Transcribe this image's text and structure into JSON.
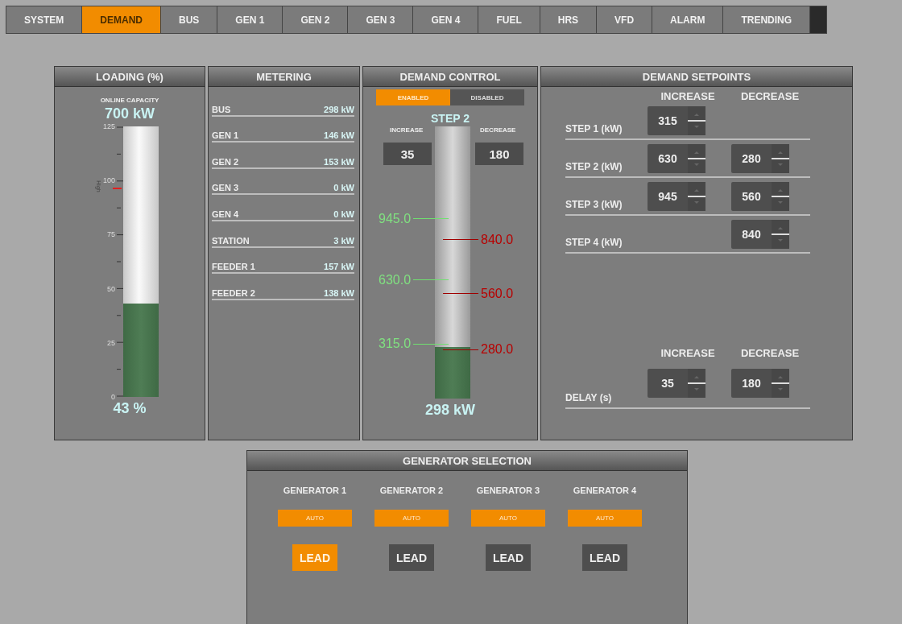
{
  "tabs": [
    {
      "label": "SYSTEM",
      "selected": false
    },
    {
      "label": "DEMAND",
      "selected": true
    },
    {
      "label": "BUS",
      "selected": false
    },
    {
      "label": "GEN 1",
      "selected": false
    },
    {
      "label": "GEN 2",
      "selected": false
    },
    {
      "label": "GEN 3",
      "selected": false
    },
    {
      "label": "GEN 4",
      "selected": false
    },
    {
      "label": "FUEL",
      "selected": false
    },
    {
      "label": "HRS",
      "selected": false
    },
    {
      "label": "VFD",
      "selected": false
    },
    {
      "label": "ALARM",
      "selected": false
    },
    {
      "label": "TRENDING",
      "selected": false
    }
  ],
  "loading": {
    "title": "LOADING (%)",
    "capacity_label": "ONLINE CAPACITY",
    "capacity": "700 kW",
    "scale": [
      "125",
      "100",
      "75",
      "50",
      "25",
      "0"
    ],
    "high_mark": {
      "label": "High",
      "level": 0.77
    },
    "level": 0.344,
    "reading": "43 %"
  },
  "metering": {
    "title": "METERING",
    "rows": [
      {
        "label": "BUS",
        "value": "298 kW"
      },
      {
        "label": "GEN 1",
        "value": "146 kW"
      },
      {
        "label": "GEN 2",
        "value": "153 kW"
      },
      {
        "label": "GEN 3",
        "value": "0 kW"
      },
      {
        "label": "GEN 4",
        "value": "0 kW"
      },
      {
        "label": "STATION",
        "value": "3 kW"
      },
      {
        "label": "FEEDER 1",
        "value": "157 kW"
      },
      {
        "label": "FEEDER 2",
        "value": "138 kW"
      }
    ]
  },
  "demand_control": {
    "title": "DEMAND CONTROL",
    "modes": [
      {
        "label": "ENABLED",
        "selected": true
      },
      {
        "label": "DISABLED",
        "selected": false
      }
    ],
    "step": "STEP 2",
    "increase_label": "INCREASE",
    "increase": "35",
    "decrease_label": "DECREASE",
    "decrease": "180",
    "level": 0.19,
    "reading": "298 kW",
    "increase_marks": [
      {
        "label": "945.0",
        "level": 0.66
      },
      {
        "label": "630.0",
        "level": 0.435
      },
      {
        "label": "315.0",
        "level": 0.2
      }
    ],
    "decrease_marks": [
      {
        "label": "840.0",
        "level": 0.583
      },
      {
        "label": "560.0",
        "level": 0.385
      },
      {
        "label": "280.0",
        "level": 0.18
      }
    ]
  },
  "setpoints": {
    "title": "DEMAND SETPOINTS",
    "columns": [
      "INCREASE",
      "DECREASE"
    ],
    "rows": [
      {
        "label": "STEP 1 (kW)",
        "increase": "315"
      },
      {
        "label": "STEP 2 (kW)",
        "increase": "630",
        "decrease": "280"
      },
      {
        "label": "STEP 3 (kW)",
        "increase": "945",
        "decrease": "560"
      },
      {
        "label": "STEP 4 (kW)",
        "decrease": "840"
      }
    ],
    "delay_columns": [
      "INCREASE",
      "DECREASE"
    ],
    "delay": {
      "label": "DELAY (s)",
      "increase": "35",
      "decrease": "180"
    }
  },
  "generator_selection": {
    "title": "GENERATOR SELECTION",
    "generators": [
      {
        "name": "GENERATOR 1",
        "mode": "AUTO",
        "lead": "LEAD",
        "selected": true
      },
      {
        "name": "GENERATOR 2",
        "mode": "AUTO",
        "lead": "LEAD",
        "selected": false
      },
      {
        "name": "GENERATOR 3",
        "mode": "AUTO",
        "lead": "LEAD",
        "selected": false
      },
      {
        "name": "GENERATOR 4",
        "mode": "AUTO",
        "lead": "LEAD",
        "selected": false
      }
    ]
  }
}
